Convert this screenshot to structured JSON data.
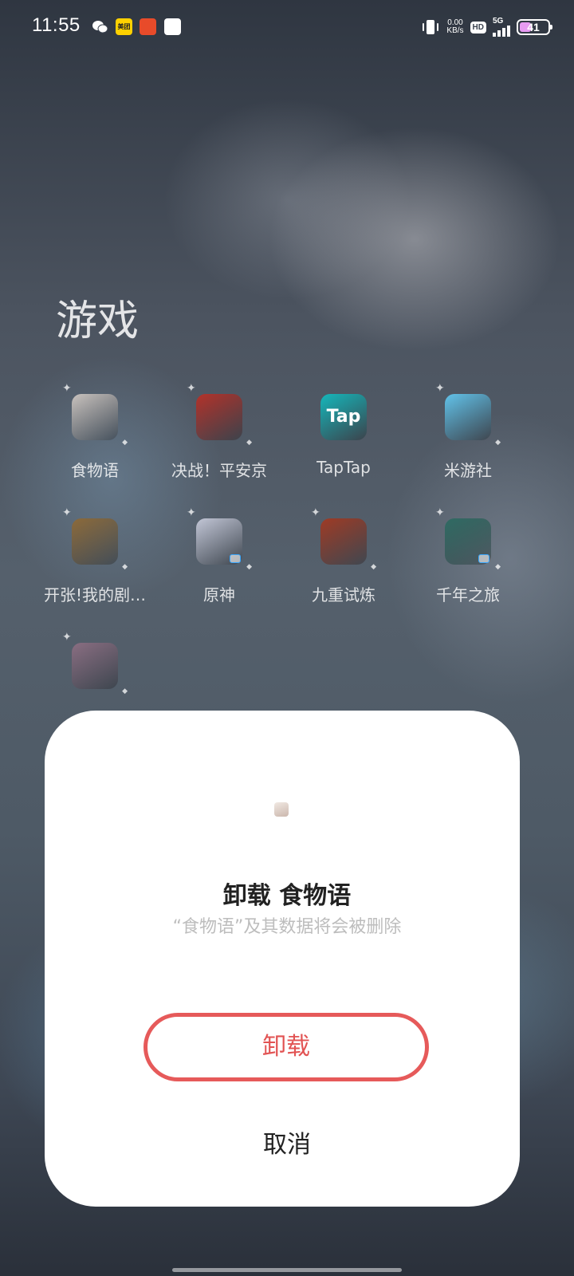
{
  "status_bar": {
    "time": "11:55",
    "notifications": [
      "wechat-icon",
      "meituan-icon",
      "app-notification-icon",
      "blank-notification-icon"
    ],
    "meituan_label": "美团",
    "net_speed_value": "0.00",
    "net_speed_unit": "KB/s",
    "hd_label": "HD",
    "signal_label": "5G",
    "battery_level": "41",
    "battery_fill_percent": 41
  },
  "folder": {
    "title": "游戏",
    "apps": [
      {
        "label": "食物语",
        "icon": "shiwuyu-icon",
        "color": "#c9c3bf"
      },
      {
        "label": "决战！平安京",
        "icon": "juezhan-pinganjing-icon",
        "color": "#b3322a"
      },
      {
        "label": "TapTap",
        "icon": "taptap-icon",
        "color": "#15b7bb",
        "icon_text": "Tap"
      },
      {
        "label": "米游社",
        "icon": "miyoushe-icon",
        "color": "#62c3ea"
      },
      {
        "label": "开张!我的剧…",
        "icon": "kaizhang-icon",
        "color": "#8c6a3a"
      },
      {
        "label": "原神",
        "icon": "genshin-icon",
        "color": "#c2c6d6"
      },
      {
        "label": "九重试炼",
        "icon": "jiuchong-shilian-icon",
        "color": "#9f3b25"
      },
      {
        "label": "千年之旅",
        "icon": "qiannian-zhilv-icon",
        "color": "#2f6b63"
      },
      {
        "label": "",
        "icon": "unnamed-game-icon",
        "color": "#8a6e82"
      }
    ]
  },
  "dialog": {
    "title": "卸载 食物语",
    "message": "“食物语”及其数据将会被删除",
    "uninstall_label": "卸载",
    "cancel_label": "取消",
    "accent_color": "#e65a5a"
  }
}
